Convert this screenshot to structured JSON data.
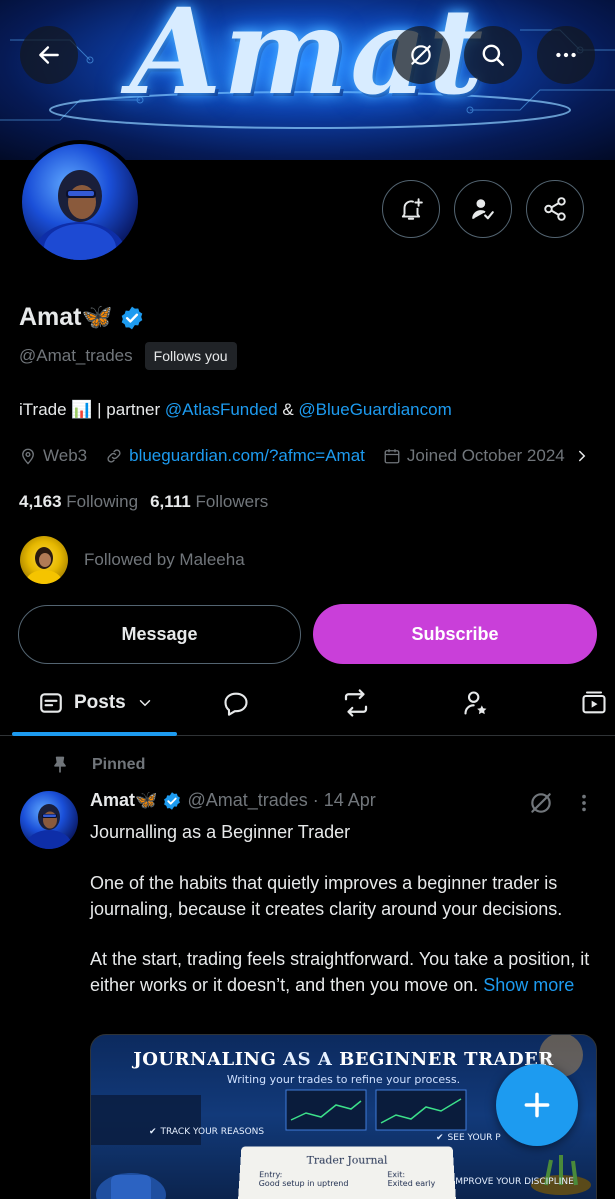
{
  "banner": {
    "text": "Amat"
  },
  "header": {
    "back_icon": "arrow-left-icon",
    "grok_icon": "grok-icon",
    "search_icon": "search-icon",
    "more_icon": "more-horizontal-icon"
  },
  "actions": {
    "notify_icon": "bell-plus-icon",
    "following_icon": "person-check-icon",
    "share_icon": "share-icon"
  },
  "profile": {
    "name": "Amat",
    "emoji": "🦋",
    "verified_color": "#1d9bf0",
    "handle": "@Amat_trades",
    "follows_you": "Follows you",
    "bio": {
      "prefix": "iTrade 📊 | partner ",
      "mention1": "@AtlasFunded",
      "mid": " & ",
      "mention2": "@BlueGuardiancom"
    },
    "location": "Web3",
    "website": "blueguardian.com/?afmc=Amat",
    "joined": "Joined October 2024",
    "following_count": "4,163",
    "following_label": "Following",
    "followers_count": "6,111",
    "followers_label": "Followers",
    "followed_by": "Followed by Maleeha"
  },
  "buttons": {
    "message": "Message",
    "subscribe": "Subscribe",
    "subscribe_color": "#c93fd9"
  },
  "tabs": {
    "posts": "Posts",
    "items": [
      "posts-icon",
      "replies-icon",
      "reposts-icon",
      "highlights-icon",
      "media-icon"
    ]
  },
  "post": {
    "pinned_label": "Pinned",
    "author": "Amat",
    "emoji": "🦋",
    "handle": "@Amat_trades",
    "separator": "·",
    "date": "14 Apr",
    "line1": "Journalling as a Beginner Trader",
    "para1": "One of the habits that quietly improves a beginner trader is journaling, because it creates clarity around your decisions.",
    "para2": "At the start, trading feels straightforward. You take a position, it either works or it doesn’t, and then you move on.",
    "show_more": "Show more",
    "media": {
      "title_a": "JOURNALING",
      "title_b": " AS A ",
      "title_c": "BEGINNER TRADER",
      "subtitle": "Writing your trades to refine your process.",
      "chip1": "TRACK YOUR REASONS",
      "chip2": "SEE YOUR P",
      "chip3": "IMPROVE YOUR DISCIPLINE",
      "journal_title": "Trader Journal",
      "entry": "Entry:",
      "exit": "Exit:",
      "entry_note": "Good setup in uptrend",
      "exit_note": "Exited early"
    }
  },
  "fab": {
    "icon": "plus-icon"
  }
}
